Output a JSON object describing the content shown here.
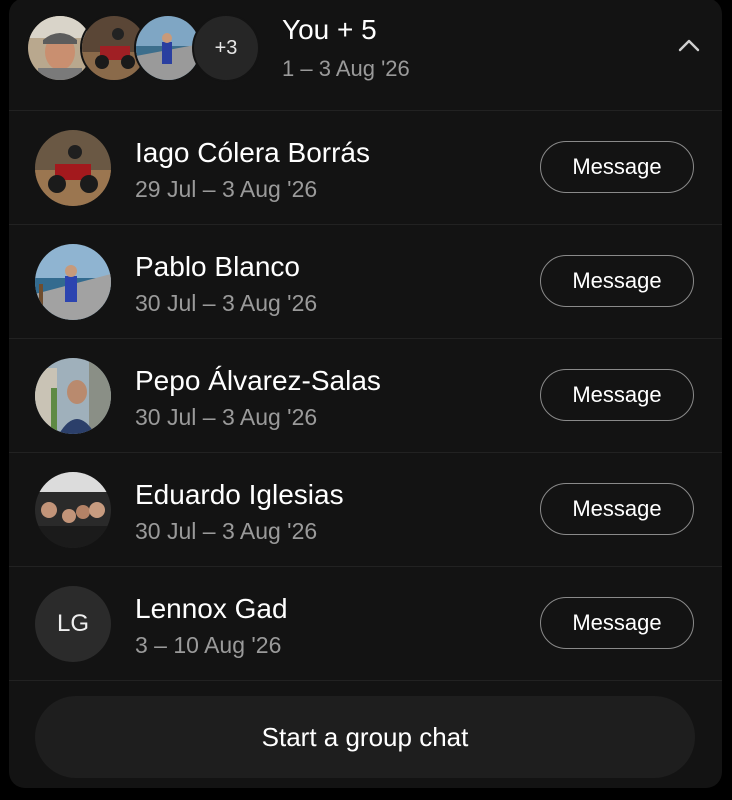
{
  "header": {
    "title": "You + 5",
    "subtitle": "1 – 3 Aug '26",
    "more_count": "+3",
    "collapse_icon": "chevron-up-icon"
  },
  "people": [
    {
      "name": "Iago Cólera Borrás",
      "dates": "29 Jul – 3 Aug '26",
      "button": "Message",
      "avatar": "photo"
    },
    {
      "name": "Pablo Blanco",
      "dates": "30 Jul – 3 Aug '26",
      "button": "Message",
      "avatar": "photo"
    },
    {
      "name": "Pepo Álvarez-Salas",
      "dates": "30 Jul – 3 Aug '26",
      "button": "Message",
      "avatar": "photo"
    },
    {
      "name": "Eduardo Iglesias",
      "dates": "30 Jul – 3 Aug '26",
      "button": "Message",
      "avatar": "photo"
    },
    {
      "name": "Lennox Gad",
      "dates": "3 – 10 Aug '26",
      "button": "Message",
      "avatar": "initials",
      "initials": "LG"
    }
  ],
  "footer": {
    "group_chat_label": "Start a group chat"
  },
  "colors": {
    "panel": "#131313",
    "secondary_text": "#9a9a9a",
    "button_border": "#8a8a8a"
  }
}
